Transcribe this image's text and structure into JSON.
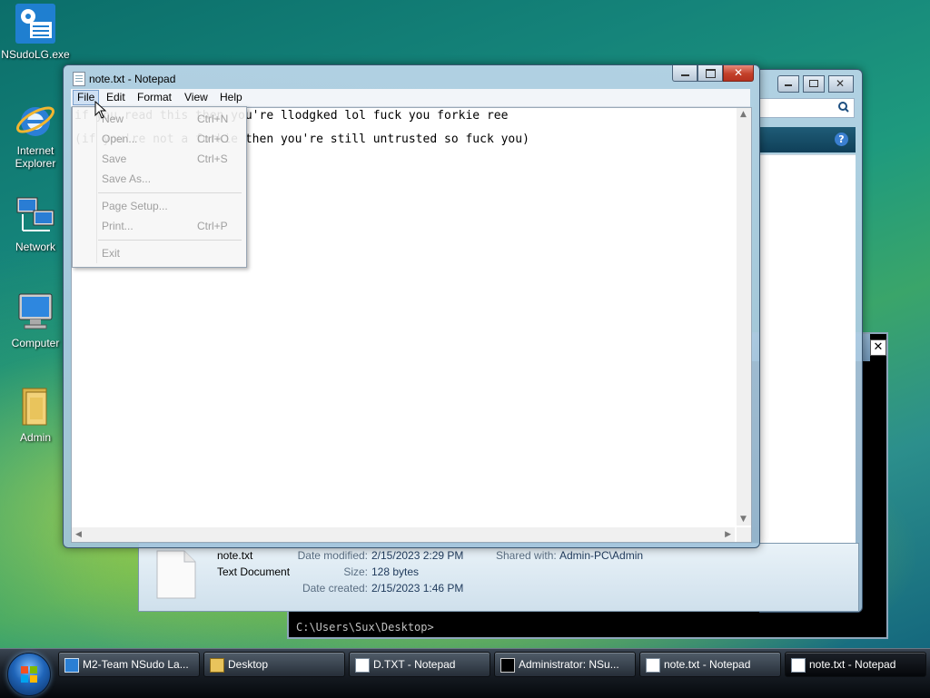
{
  "desktop": {
    "icons": [
      {
        "label": "NSudoLG.exe",
        "icon": "nsudo-gear-icon"
      },
      {
        "label": "Internet Explorer",
        "icon": "internet-explorer-icon"
      },
      {
        "label": "Network",
        "icon": "network-icon"
      },
      {
        "label": "Computer",
        "icon": "computer-icon"
      },
      {
        "label": "Admin",
        "icon": "user-folder-icon"
      }
    ]
  },
  "explorer": {
    "details": {
      "file_name": "note.txt",
      "file_type": "Text Document",
      "date_modified_label": "Date modified:",
      "date_modified": "2/15/2023 2:29 PM",
      "size_label": "Size:",
      "size": "128 bytes",
      "date_created_label": "Date created:",
      "date_created": "2/15/2023 1:46 PM",
      "shared_with_label": "Shared with:",
      "shared_with": "Admin-PC\\Admin"
    }
  },
  "console": {
    "prompt": "C:\\Users\\Sux\\Desktop>"
  },
  "notepad": {
    "title": "note.txt - Notepad",
    "menu": [
      "File",
      "Edit",
      "Format",
      "View",
      "Help"
    ],
    "lines": [
      "if you read this then you're llodgked lol fuck you forkie ree",
      "(if you're not a forkie then you're still untrusted so fuck you)"
    ]
  },
  "file_menu": {
    "items": [
      {
        "label": "New",
        "shortcut": "Ctrl+N"
      },
      {
        "label": "Open...",
        "shortcut": "Ctrl+O"
      },
      {
        "label": "Save",
        "shortcut": "Ctrl+S"
      },
      {
        "label": "Save As...",
        "shortcut": ""
      },
      {
        "label": "Page Setup...",
        "shortcut": ""
      },
      {
        "label": "Print...",
        "shortcut": "Ctrl+P"
      },
      {
        "label": "Exit",
        "shortcut": ""
      }
    ]
  },
  "taskbar": {
    "buttons": [
      {
        "label": "M2-Team NSudo La...",
        "icon": "nsudo-icon"
      },
      {
        "label": "Desktop",
        "icon": "folder-icon"
      },
      {
        "label": "D.TXT - Notepad",
        "icon": "notepad-icon"
      },
      {
        "label": "Administrator: NSu...",
        "icon": "console-icon"
      },
      {
        "label": "note.txt - Notepad",
        "icon": "notepad-icon"
      },
      {
        "label": "note.txt - Notepad",
        "icon": "notepad-icon"
      }
    ]
  }
}
